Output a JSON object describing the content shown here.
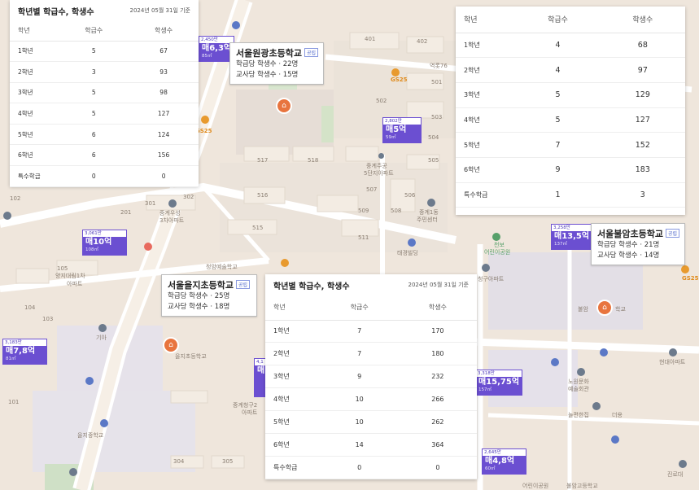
{
  "tables": [
    {
      "id": "p1",
      "title": "학년별 학급수, 학생수",
      "date": "2024년 05월 31일 기준",
      "headers": [
        "학년",
        "학급수",
        "학생수"
      ],
      "rows": [
        [
          "1학년",
          "5",
          "67"
        ],
        [
          "2학년",
          "3",
          "93"
        ],
        [
          "3학년",
          "5",
          "98"
        ],
        [
          "4학년",
          "5",
          "127"
        ],
        [
          "5학년",
          "6",
          "124"
        ],
        [
          "6학년",
          "6",
          "156"
        ],
        [
          "특수학급",
          "0",
          "0"
        ]
      ]
    },
    {
      "id": "p2",
      "title": "",
      "date": "",
      "headers": [
        "학년",
        "학급수",
        "학생수"
      ],
      "rows": [
        [
          "1학년",
          "4",
          "68"
        ],
        [
          "2학년",
          "4",
          "97"
        ],
        [
          "3학년",
          "5",
          "129"
        ],
        [
          "4학년",
          "5",
          "127"
        ],
        [
          "5학년",
          "7",
          "152"
        ],
        [
          "6학년",
          "9",
          "183"
        ],
        [
          "특수학급",
          "1",
          "3"
        ]
      ]
    },
    {
      "id": "p3",
      "title": "학년별 학급수, 학생수",
      "date": "2024년 05월 31일 기준",
      "headers": [
        "학년",
        "학급수",
        "학생수"
      ],
      "rows": [
        [
          "1학년",
          "7",
          "170"
        ],
        [
          "2학년",
          "7",
          "180"
        ],
        [
          "3학년",
          "9",
          "232"
        ],
        [
          "4학년",
          "10",
          "266"
        ],
        [
          "5학년",
          "10",
          "262"
        ],
        [
          "6학년",
          "14",
          "364"
        ],
        [
          "특수학급",
          "0",
          "0"
        ]
      ]
    }
  ],
  "schools": [
    {
      "name": "서울원광초등학교",
      "tag": "공립",
      "line1": "학급당 학생수 · 22명",
      "line2": "교사당 학생수 · 15명"
    },
    {
      "name": "서울불암초등학교",
      "tag": "공립",
      "line1": "학급당 학생수 · 21명",
      "line2": "교사당 학생수 · 14명"
    },
    {
      "name": "서울을지초등학교",
      "tag": "공립",
      "line1": "학급당 학생수 · 25명",
      "line2": "교사당 학생수 · 18명"
    }
  ],
  "prices": [
    {
      "top": "2,450만",
      "value": "매6,3억",
      "area": "85㎡"
    },
    {
      "top": "2,802만",
      "value": "매5억",
      "area": "59㎡"
    },
    {
      "top": "3,061만",
      "value": "매10억",
      "area": "108㎡"
    },
    {
      "top": "3,258만",
      "value": "매13,5억",
      "area": "137㎡"
    },
    {
      "top": "3,183만",
      "value": "매7,8억",
      "area": "81㎡"
    },
    {
      "top": "4,1",
      "value": "매",
      "area": ""
    },
    {
      "top": "3,318만",
      "value": "매15,75억",
      "area": "157㎡"
    },
    {
      "top": "2,645만",
      "value": "매4,8억",
      "area": "60㎡"
    }
  ],
  "map_labels": {
    "gs25_a": "GS25",
    "gs25_b": "GS25",
    "gs25_c": "GS25",
    "junggye_jugong": "중계주공",
    "junggye_jugong_2": "5단지아파트",
    "junggye_1dong": "중계1동",
    "junggye_1dong_2": "주민센터",
    "taegyeong": "태경빌딩",
    "junggye_woosung": "중계우성",
    "junggye_woosung_2": "3차아파트",
    "daerim": "양지대림1차",
    "daerim_2": "아파트",
    "giya": "기아",
    "euljichodeung": "을지초등학교",
    "euljijung": "을지중학교",
    "cheongam": "청암예술학교",
    "cheongbo": "천보",
    "cheongbo_2": "어린이공원",
    "cheonggu": "청구아파트",
    "nowon_art": "노원문화",
    "nowon_art_2": "예술회관",
    "hyundai": "현대아파트",
    "junggye_cheonggu": "중계청구2",
    "junggye_cheonggu_2": "아파트",
    "bulam_label": "불암",
    "hakgyo": "학교",
    "nongbin": "놀편한집",
    "deokdo": "더용",
    "park": "어린이공원",
    "bulam_high": "불암고등학교",
    "jinro": "진로대",
    "building_517": "517",
    "building_518": "518",
    "building_516": "516",
    "building_515": "515",
    "building_511": "511",
    "building_509": "509",
    "building_508": "508",
    "building_507": "507",
    "building_506": "506",
    "building_505": "505",
    "building_504": "504",
    "building_503": "503",
    "building_502": "502",
    "building_501": "501",
    "building_402": "402",
    "building_401": "401",
    "building_302": "302",
    "building_301": "301",
    "building_201": "201",
    "building_102": "102",
    "building_103": "103",
    "building_104": "104",
    "building_105": "105",
    "building_101": "101",
    "building_305": "305",
    "building_304": "304",
    "road_label": "역롯76"
  },
  "colors": {
    "price_purple": "#6b4fd1",
    "school_marker": "#e8743e",
    "map_bg": "#efe6dc"
  }
}
